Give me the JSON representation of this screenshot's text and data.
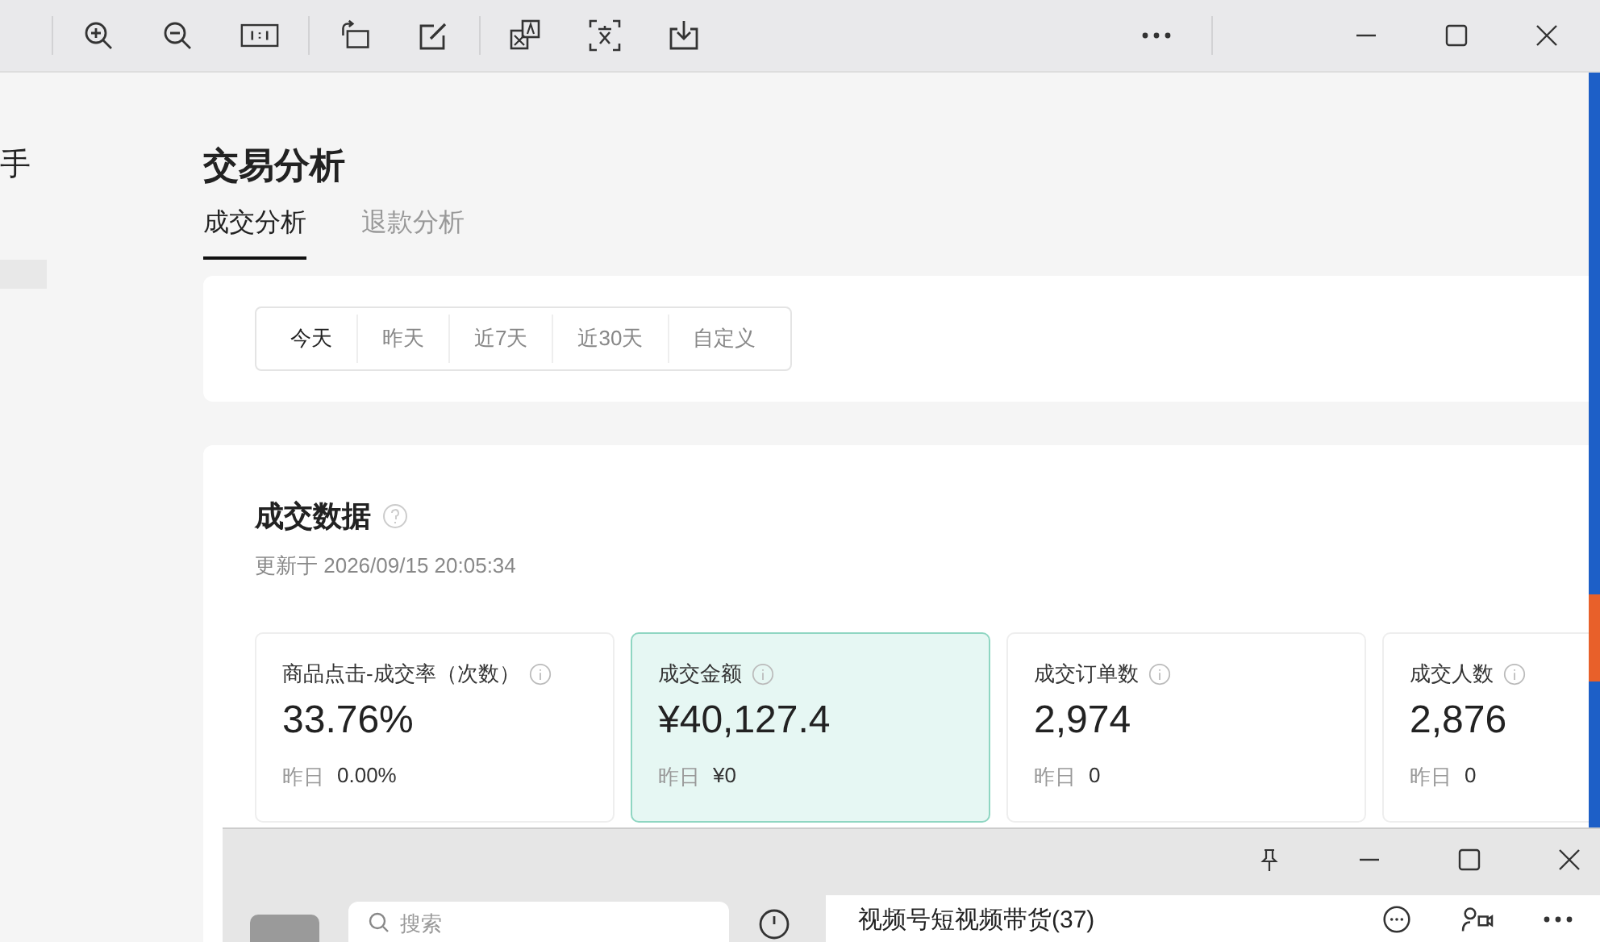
{
  "sidebar": {
    "title_fragment": "手"
  },
  "page": {
    "title": "交易分析",
    "tabs": [
      {
        "label": "成交分析",
        "selected": true
      },
      {
        "label": "退款分析",
        "selected": false
      }
    ],
    "date_filter": [
      {
        "label": "今天",
        "selected": true
      },
      {
        "label": "昨天",
        "selected": false
      },
      {
        "label": "近7天",
        "selected": false
      },
      {
        "label": "近30天",
        "selected": false
      },
      {
        "label": "自定义",
        "selected": false
      }
    ],
    "data_section": {
      "title": "成交数据",
      "updated": "更新于 2026/09/15 20:05:34",
      "metrics": [
        {
          "label": "商品点击-成交率（次数）",
          "value": "33.76%",
          "yesterday_label": "昨日",
          "yesterday_value": "0.00%",
          "selected": false
        },
        {
          "label": "成交金额",
          "value": "¥40,127.4",
          "yesterday_label": "昨日",
          "yesterday_value": "¥0",
          "selected": true
        },
        {
          "label": "成交订单数",
          "value": "2,974",
          "yesterday_label": "昨日",
          "yesterday_value": "0",
          "selected": false
        },
        {
          "label": "成交人数",
          "value": "2,876",
          "yesterday_label": "昨日",
          "yesterday_value": "0",
          "selected": false
        }
      ]
    }
  },
  "chat_window": {
    "search": {
      "placeholder": "搜索"
    },
    "conversation_title": "视频号短视频带货(37)"
  }
}
